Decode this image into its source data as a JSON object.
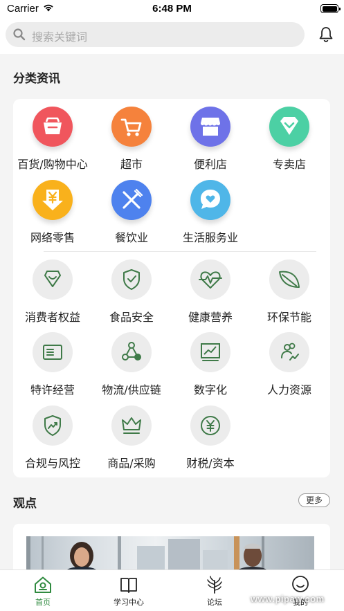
{
  "status_bar": {
    "carrier": "Carrier",
    "time": "6:48 PM"
  },
  "search": {
    "placeholder": "搜索关键词"
  },
  "categories": {
    "title": "分类资讯",
    "items": [
      {
        "label": "百货/购物中心",
        "icon": "shopping-basket-icon",
        "color": "#f0565d"
      },
      {
        "label": "超市",
        "icon": "shopping-cart-icon",
        "color": "#f5823c"
      },
      {
        "label": "便利店",
        "icon": "storefront-icon",
        "color": "#6e72e8"
      },
      {
        "label": "专卖店",
        "icon": "badge-shield-icon",
        "color": "#4cd0a4"
      },
      {
        "label": "网络零售",
        "icon": "yen-download-icon",
        "color": "#f9b11c"
      },
      {
        "label": "餐饮业",
        "icon": "fork-knife-icon",
        "color": "#4e82ee"
      },
      {
        "label": "生活服务业",
        "icon": "heart-chat-icon",
        "color": "#4fb6e8"
      }
    ]
  },
  "topics": {
    "items": [
      {
        "label": "消费者权益",
        "icon": "shield-smile-icon"
      },
      {
        "label": "食品安全",
        "icon": "shield-check-icon"
      },
      {
        "label": "健康营养",
        "icon": "heart-pulse-icon"
      },
      {
        "label": "环保节能",
        "icon": "leaf-icon"
      },
      {
        "label": "特许经营",
        "icon": "license-card-icon"
      },
      {
        "label": "物流/供应链",
        "icon": "network-nodes-icon"
      },
      {
        "label": "数字化",
        "icon": "chart-monitor-icon"
      },
      {
        "label": "人力资源",
        "icon": "people-growth-icon"
      },
      {
        "label": "合规与风控",
        "icon": "shield-trend-icon"
      },
      {
        "label": "商品/采购",
        "icon": "crown-icon"
      },
      {
        "label": "财税/资本",
        "icon": "yen-coin-icon"
      }
    ],
    "accent": "#3f7a48"
  },
  "opinions": {
    "title": "观点",
    "more_label": "更多"
  },
  "tabbar": {
    "tabs": [
      {
        "label": "首页",
        "icon": "home-icon",
        "active": true
      },
      {
        "label": "学习中心",
        "icon": "book-icon",
        "active": false
      },
      {
        "label": "论坛",
        "icon": "plant-icon",
        "active": false
      },
      {
        "label": "我的",
        "icon": "user-icon",
        "active": false
      }
    ],
    "active_color": "#2f8a3f"
  },
  "watermark": "www.pipaw.com"
}
